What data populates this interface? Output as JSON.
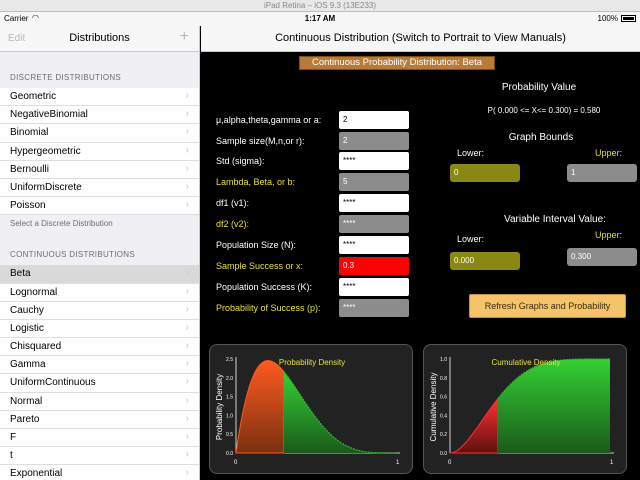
{
  "simulator": {
    "title": "iPad Retina – iOS 9.3 (13E233)"
  },
  "status_bar": {
    "carrier": "Carrier",
    "time": "1:17 AM",
    "battery": "100%"
  },
  "sidebar": {
    "edit_label": "Edit",
    "title": "Distributions",
    "discrete_header": "DISCRETE DISTRIBUTIONS",
    "discrete_items": [
      "Geometric",
      "NegativeBinomial",
      "Binomial",
      "Hypergeometric",
      "Bernoulli",
      "UniformDiscrete",
      "Poisson"
    ],
    "discrete_footer": "Select a Discrete Distribution",
    "continuous_header": "CONTINUOUS DISTRIBUTIONS",
    "continuous_items": [
      "Beta",
      "Lognormal",
      "Cauchy",
      "Logistic",
      "Chisquared",
      "Gamma",
      "UniformContinuous",
      "Normal",
      "Pareto",
      "F",
      "t",
      "Exponential"
    ],
    "selected": "Beta"
  },
  "main": {
    "nav_title": "Continuous Distribution (Switch to Portrait to View Manuals)",
    "banner": "Continuous Probability Distribution: Beta",
    "params": [
      {
        "label": "μ,alpha,theta,gamma or a:",
        "value": "2",
        "style": "w",
        "color": "white"
      },
      {
        "label": "Sample size(M,n,or r):",
        "value": "2",
        "style": "g",
        "color": "white"
      },
      {
        "label": "Std (sigma):",
        "value": "****",
        "style": "w",
        "color": "white"
      },
      {
        "label": "Lambda, Beta, or b:",
        "value": "5",
        "style": "g",
        "color": "yellow"
      },
      {
        "label": "df1 (v1):",
        "value": "****",
        "style": "w",
        "color": "white"
      },
      {
        "label": "df2 (v2):",
        "value": "****",
        "style": "g",
        "color": "yellow"
      },
      {
        "label": "Population Size (N):",
        "value": "****",
        "style": "w",
        "color": "white"
      },
      {
        "label": "Sample Success or x:",
        "value": "0.3",
        "style": "r",
        "color": "yellow"
      },
      {
        "label": "Population Success (K):",
        "value": "****",
        "style": "w",
        "color": "white"
      },
      {
        "label": "Probability of Success (p):",
        "value": "****",
        "style": "g",
        "color": "yellow"
      }
    ],
    "probability_heading": "Probability Value",
    "probability_text": "P( 0.000 <= X<= 0.300) = 0.580",
    "graph_bounds_heading": "Graph Bounds",
    "lower_label": "Lower:",
    "upper_label": "Upper:",
    "graph_lower": "0",
    "graph_upper": "1",
    "interval_heading": "Variable Interval Value:",
    "interval_lower": "0.000",
    "interval_upper": "0.300",
    "refresh_label": "Refresh Graphs and Probability"
  },
  "charts": {
    "pdf": {
      "title": "Probability Density",
      "ylabel": "Probability Density",
      "yticks": [
        "2.5",
        "2.0",
        "1.5",
        "1.0",
        "0.5",
        "0.0"
      ],
      "xtick0": "0",
      "xtick1": "1",
      "accent": "#ff6a2a",
      "fill_right": "#2db82d"
    },
    "cdf": {
      "title": "Cumulative Density",
      "ylabel": "Cumulative Density",
      "yticks": [
        "1.0",
        "0.8",
        "0.6",
        "0.4",
        "0.2",
        "0.0"
      ],
      "xtick0": "0",
      "xtick1": "1",
      "accent": "#ff3030",
      "fill_right": "#2db82d"
    }
  }
}
